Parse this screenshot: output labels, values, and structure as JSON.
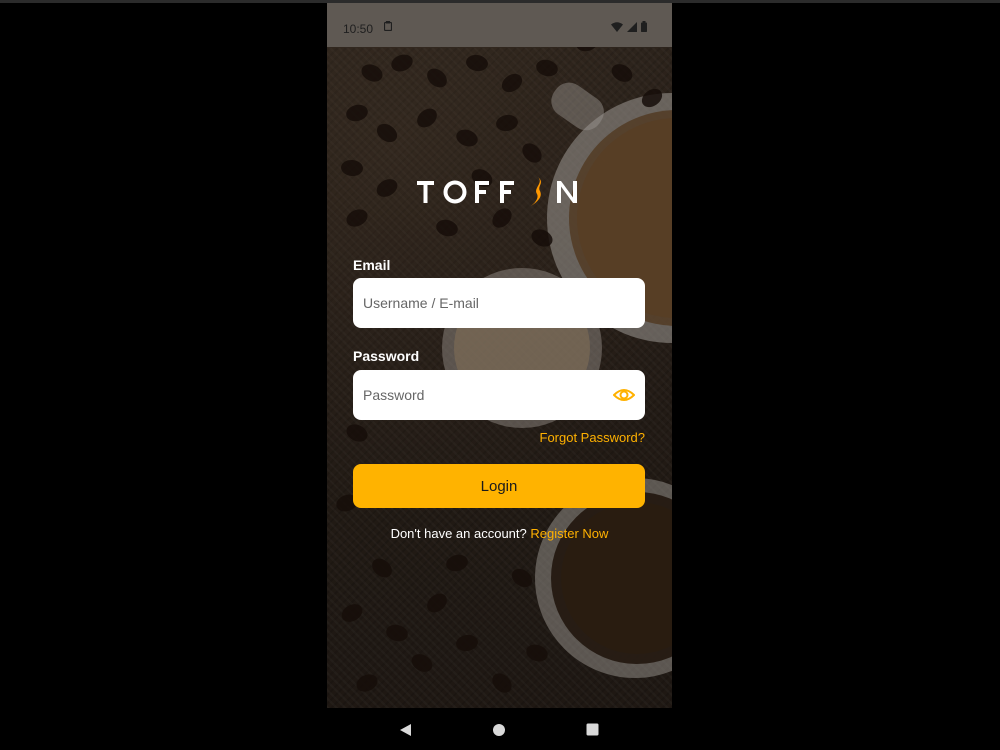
{
  "status_bar": {
    "time": "10:50",
    "notification_icon": "clipboard-icon",
    "icons": [
      "wifi-icon",
      "cellular-signal-icon",
      "battery-icon"
    ]
  },
  "brand": {
    "logo_text": "TOFFIN",
    "accent_color": "#ffb300"
  },
  "form": {
    "email_label": "Email",
    "email_placeholder": "Username / E-mail",
    "email_value": "",
    "password_label": "Password",
    "password_placeholder": "Password",
    "password_value": "",
    "password_toggle_icon": "eye-icon",
    "forgot_password": "Forgot Password?",
    "login_button": "Login"
  },
  "register": {
    "prompt": "Don't have an account?",
    "link": "Register Now"
  },
  "nav_bar": {
    "buttons": [
      "back-icon",
      "home-icon",
      "recents-icon"
    ]
  }
}
